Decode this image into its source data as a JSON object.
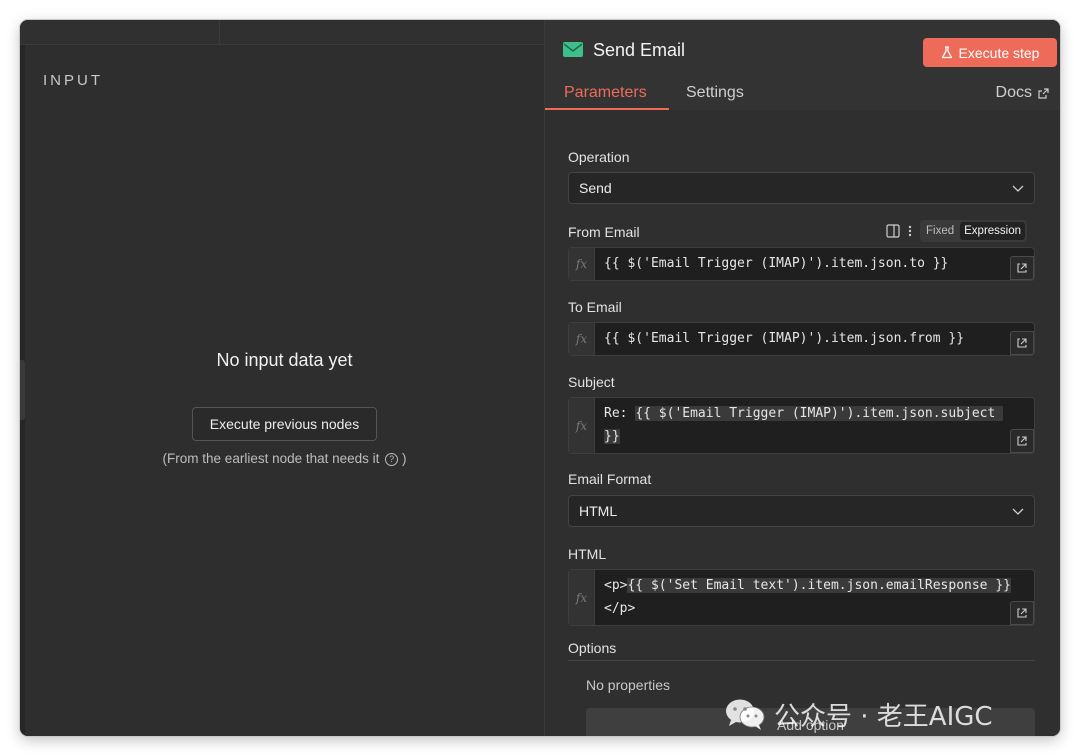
{
  "input_panel": {
    "title": "INPUT",
    "empty_title": "No input data yet",
    "execute_previous_label": "Execute previous nodes",
    "hint": "(From the earliest node that needs it",
    "hint_suffix": ")"
  },
  "node": {
    "title": "Send Email",
    "execute_label": "Execute step",
    "tabs": [
      {
        "label": "Parameters",
        "active": true
      },
      {
        "label": "Settings",
        "active": false
      }
    ],
    "docs_label": "Docs"
  },
  "params": {
    "operation": {
      "label": "Operation",
      "value": "Send"
    },
    "from_email": {
      "label": "From Email",
      "mode_fixed": "Fixed",
      "mode_expression": "Expression",
      "expression": "{{ $('Email Trigger (IMAP)').item.json.to }}"
    },
    "to_email": {
      "label": "To Email",
      "expression": "{{ $('Email Trigger (IMAP)').item.json.from }}"
    },
    "subject": {
      "label": "Subject",
      "prefix": "Re: ",
      "expression": "{{ $('Email Trigger (IMAP)').item.json.subject }}"
    },
    "email_format": {
      "label": "Email Format",
      "value": "HTML"
    },
    "html": {
      "label": "HTML",
      "open_tag": "<p>",
      "expression": "{{ $('Set Email text').item.json.emailResponse }}",
      "close_tag": "</p>"
    },
    "options": {
      "label": "Options",
      "no_properties": "No properties",
      "add_option_label": "Add option"
    }
  },
  "watermark": {
    "text": "公众号 · 老王AIGC"
  },
  "colors": {
    "accent": "#ee6b5a",
    "email_icon": "#3fbf8b"
  }
}
